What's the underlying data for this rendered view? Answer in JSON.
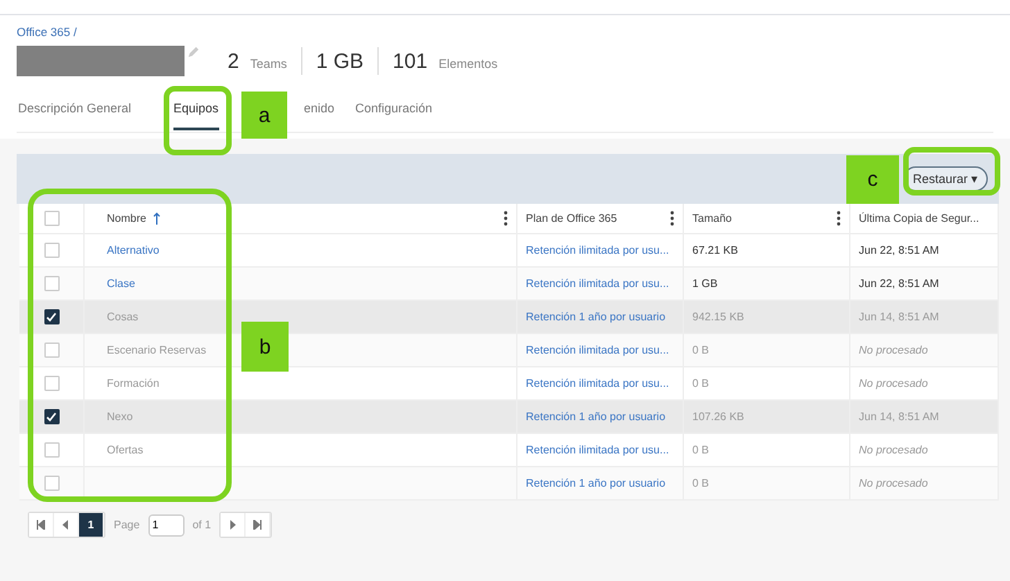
{
  "breadcrumb": "Office 365 /",
  "stats": [
    {
      "value": "2",
      "label": "Teams"
    },
    {
      "value": "1 GB"
    },
    {
      "value": "101",
      "label": "Elementos"
    }
  ],
  "tabs": [
    {
      "label": "Descripción General",
      "selected": false
    },
    {
      "label": "Equipos",
      "selected": true
    },
    {
      "label": "enido",
      "selected": false
    },
    {
      "label": "Configuración",
      "selected": false
    }
  ],
  "toolbar": {
    "restore_button": "Restaurar ▾"
  },
  "table": {
    "columns": [
      {
        "label": "Nombre",
        "sorted": true,
        "menu": true
      },
      {
        "label": "Plan de Office 365",
        "sorted": false,
        "menu": true
      },
      {
        "label": "Tamaño",
        "sorted": false,
        "menu": true
      },
      {
        "label": "Última Copia de Segur...",
        "sorted": false,
        "menu": false
      }
    ],
    "header_checked": false,
    "rows": [
      {
        "name": "Alternativo",
        "plan": "Retención ilimitada por usu...",
        "size": "67.21 KB",
        "backup": "Jun 22, 8:51 AM",
        "checked": false,
        "active": true,
        "processed": true
      },
      {
        "name": "Clase",
        "plan": "Retención ilimitada por usu...",
        "size": "1 GB",
        "backup": "Jun 22, 8:51 AM",
        "checked": false,
        "active": true,
        "processed": true
      },
      {
        "name": "Cosas",
        "plan": "Retención 1 año por usuario",
        "size": "942.15 KB",
        "backup": "Jun 14, 8:51 AM",
        "checked": true,
        "active": false,
        "processed": true
      },
      {
        "name": "Escenario Reservas",
        "plan": "Retención ilimitada por usu...",
        "size": "0 B",
        "backup": "No procesado",
        "checked": false,
        "active": false,
        "processed": false
      },
      {
        "name": "Formación",
        "plan": "Retención ilimitada por usu...",
        "size": "0 B",
        "backup": "No procesado",
        "checked": false,
        "active": false,
        "processed": false
      },
      {
        "name": "Nexo",
        "plan": "Retención 1 año por usuario",
        "size": "107.26 KB",
        "backup": "Jun 14, 8:51 AM",
        "checked": true,
        "active": false,
        "processed": true
      },
      {
        "name": "Ofertas",
        "plan": "Retención ilimitada por usu...",
        "size": "0 B",
        "backup": "No procesado",
        "checked": false,
        "active": false,
        "processed": false
      },
      {
        "plan": "Retención 1 año por usuario",
        "size": "0 B",
        "backup": "No procesado",
        "checked": false,
        "active": false,
        "processed": false
      }
    ]
  },
  "pagination": {
    "current": "1",
    "page_label": "Page",
    "page_value": "1",
    "of": "of 1"
  },
  "callouts": [
    {
      "label": "a",
      "kind": "tab"
    },
    {
      "label": "b",
      "kind": "checkboxes"
    },
    {
      "label": "c",
      "kind": "restore"
    }
  ]
}
